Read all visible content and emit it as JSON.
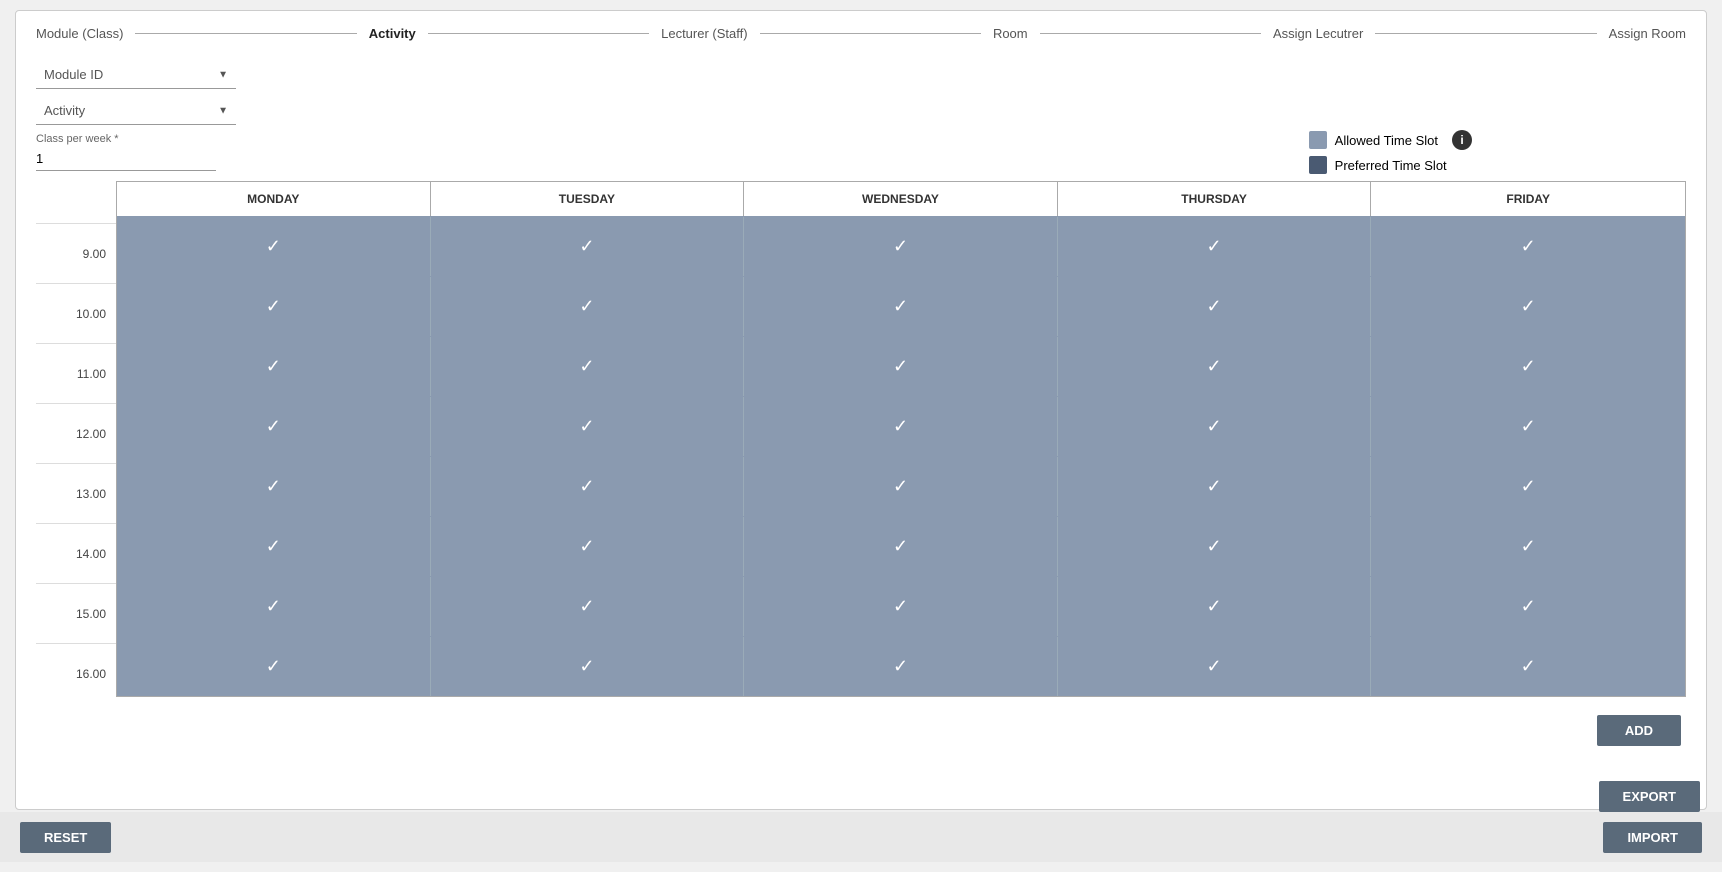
{
  "wizard": {
    "steps": [
      {
        "id": "module-class",
        "label": "Module (Class)",
        "active": false
      },
      {
        "id": "activity",
        "label": "Activity",
        "active": true
      },
      {
        "id": "lecturer-staff",
        "label": "Lecturer (Staff)",
        "active": false
      },
      {
        "id": "room",
        "label": "Room",
        "active": false
      },
      {
        "id": "assign-lecturer",
        "label": "Assign Lecutrer",
        "active": false
      },
      {
        "id": "assign-room",
        "label": "Assign Room",
        "active": false
      }
    ]
  },
  "form": {
    "module_id_label": "Module ID",
    "module_id_placeholder": "Module ID",
    "activity_label": "Activity",
    "activity_placeholder": "Activity",
    "class_per_week_label": "Class per week *",
    "class_per_week_value": "1"
  },
  "legend": {
    "allowed_label": "Allowed Time Slot",
    "preferred_label": "Preferred Time Slot"
  },
  "schedule": {
    "days": [
      "MONDAY",
      "TUESDAY",
      "WEDNESDAY",
      "THURSDAY",
      "FRIDAY"
    ],
    "times": [
      "9.00",
      "10.00",
      "11.00",
      "12.00",
      "13.00",
      "14.00",
      "15.00",
      "16.00"
    ],
    "all_checked": true
  },
  "buttons": {
    "reset_label": "RESET",
    "import_label": "IMPORT",
    "add_label": "ADD",
    "export_label": "EXPORT"
  }
}
